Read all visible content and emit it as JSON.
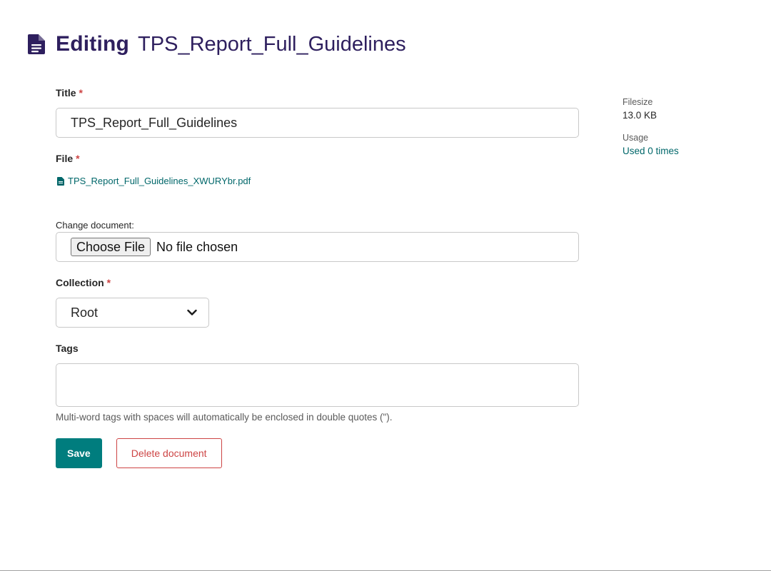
{
  "header": {
    "icon": "document-icon",
    "editing_label": "Editing",
    "document_name": "TPS_Report_Full_Guidelines"
  },
  "form": {
    "title": {
      "label": "Title",
      "required_mark": "*",
      "value": "TPS_Report_Full_Guidelines"
    },
    "file": {
      "label": "File",
      "required_mark": "*",
      "link_text": "TPS_Report_Full_Guidelines_XWURYbr.pdf",
      "icon": "file-icon"
    },
    "change_document": {
      "label": "Change document:",
      "button_label": "Choose File",
      "status": "No file chosen"
    },
    "collection": {
      "label": "Collection",
      "required_mark": "*",
      "selected": "Root",
      "icon": "chevron-down-icon"
    },
    "tags": {
      "label": "Tags",
      "value": "",
      "help_text": "Multi-word tags with spaces will automatically be enclosed in double quotes (\")."
    },
    "actions": {
      "save_label": "Save",
      "delete_label": "Delete document"
    }
  },
  "sidebar": {
    "filesize_label": "Filesize",
    "filesize_value": "13.0 KB",
    "usage_label": "Usage",
    "usage_value": "Used 0 times"
  },
  "colors": {
    "heading": "#2e1f5e",
    "accent": "#007d7e",
    "link": "#00676a",
    "danger": "#cd4444"
  }
}
